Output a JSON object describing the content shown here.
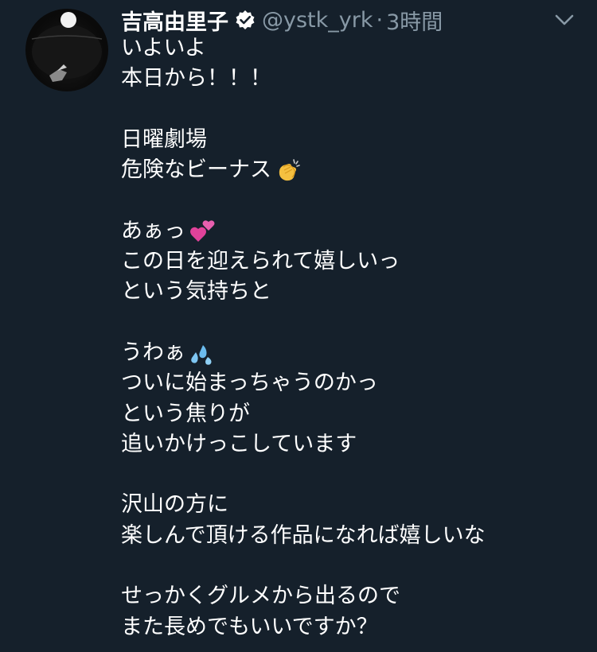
{
  "tweet": {
    "author_name": "吉高由里子",
    "handle": "@ystk_yrk",
    "separator": "·",
    "time": "3時間",
    "lines": [
      "いよいよ",
      "本日から！！！",
      "",
      "日曜劇場",
      "危険なビーナス",
      "",
      "あぁっ",
      "この日を迎えられて嬉しいっ",
      "という気持ちと",
      "",
      "うわぁ",
      "ついに始まっちゃうのかっ",
      "という焦りが",
      "追いかけっこしています",
      "",
      "沢山の方に",
      "楽しんで頂ける作品になれば嬉しいな",
      "",
      "せっかくグルメから出るので",
      "また長めでもいいですか？"
    ],
    "emojis": {
      "clapping": "clapping-hands-emoji",
      "two_hearts": "two-hearts-emoji",
      "sweat": "sweat-droplets-emoji"
    }
  },
  "colors": {
    "background": "#15202b",
    "text": "#ffffff",
    "secondary": "#8899a6"
  }
}
